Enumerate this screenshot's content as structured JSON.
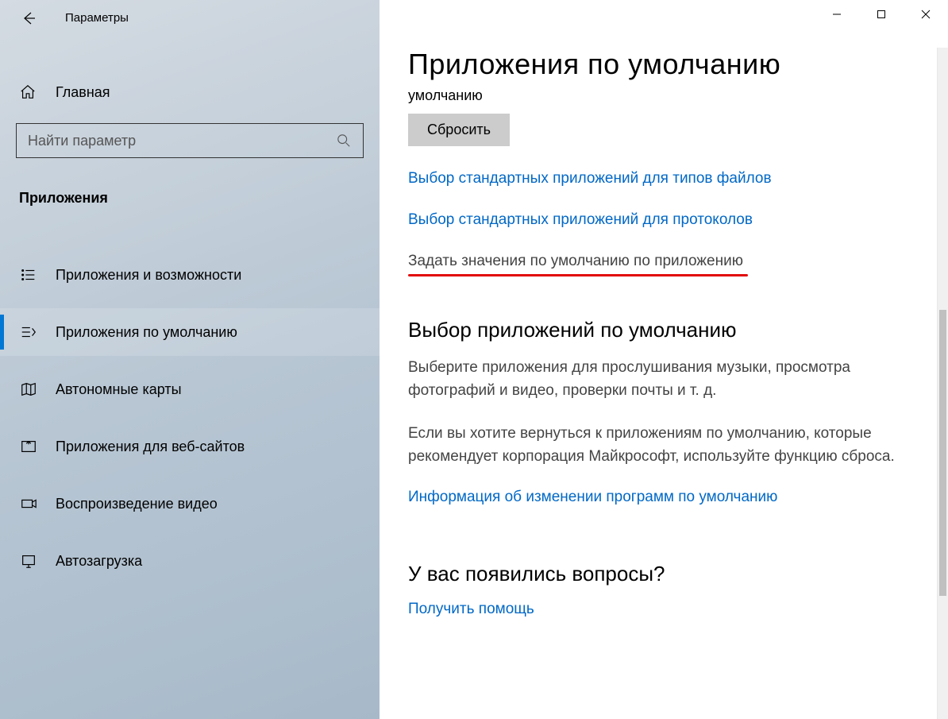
{
  "header": {
    "title": "Параметры"
  },
  "home": {
    "label": "Главная"
  },
  "search": {
    "placeholder": "Найти параметр"
  },
  "group": {
    "title": "Приложения"
  },
  "nav": {
    "items": [
      {
        "label": "Приложения и возможности"
      },
      {
        "label": "Приложения по умолчанию"
      },
      {
        "label": "Автономные карты"
      },
      {
        "label": "Приложения для веб-сайтов"
      },
      {
        "label": "Воспроизведение видео"
      },
      {
        "label": "Автозагрузка"
      }
    ]
  },
  "page": {
    "title": "Приложения по умолчанию",
    "fragment": "умолчанию",
    "reset_label": "Сбросить",
    "link_filetypes": "Выбор стандартных приложений для типов файлов",
    "link_protocols": "Выбор стандартных приложений для протоколов",
    "link_by_app": "Задать значения по умолчанию по приложению",
    "section1_title": "Выбор приложений по умолчанию",
    "section1_p1": "Выберите приложения для прослушивания музыки, просмотра фотографий и видео, проверки почты и т. д.",
    "section1_p2": "Если вы хотите вернуться к приложениям по умолчанию, которые рекомендует корпорация Майкрософт, используйте функцию сброса.",
    "info_link": "Информация об изменении программ по умолчанию",
    "questions_title": "У вас появились вопросы?",
    "help_link": "Получить помощь"
  }
}
